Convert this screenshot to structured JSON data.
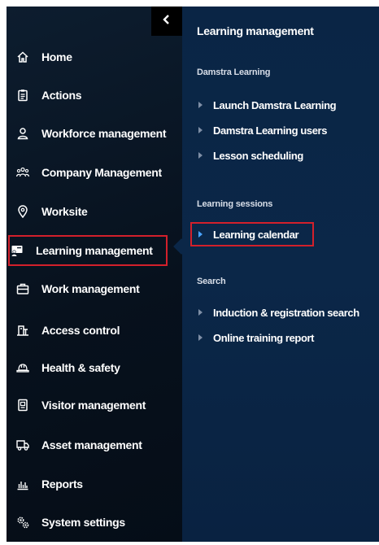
{
  "sidebar": {
    "items": [
      {
        "label": "Home",
        "icon": "home-icon"
      },
      {
        "label": "Actions",
        "icon": "clipboard-icon"
      },
      {
        "label": "Workforce management",
        "icon": "user-icon"
      },
      {
        "label": "Company Management",
        "icon": "users-group-icon"
      },
      {
        "label": "Worksite",
        "icon": "location-pin-icon"
      },
      {
        "label": "Learning management",
        "icon": "learning-presentation-icon"
      },
      {
        "label": "Work management",
        "icon": "briefcase-icon"
      },
      {
        "label": "Access control",
        "icon": "turnstile-icon"
      },
      {
        "label": "Health & safety",
        "icon": "hard-hat-icon"
      },
      {
        "label": "Visitor management",
        "icon": "badge-icon"
      },
      {
        "label": "Asset management",
        "icon": "truck-icon"
      },
      {
        "label": "Reports",
        "icon": "bar-chart-icon"
      },
      {
        "label": "System settings",
        "icon": "gears-icon"
      }
    ],
    "active_index": 5
  },
  "panel": {
    "title": "Learning management",
    "sections": [
      {
        "label": "Damstra Learning",
        "items": [
          "Launch Damstra Learning",
          "Damstra Learning users",
          "Lesson scheduling"
        ]
      },
      {
        "label": "Learning sessions",
        "items": [
          "Learning calendar"
        ]
      },
      {
        "label": "Search",
        "items": [
          "Induction & registration search",
          "Online training report"
        ]
      }
    ]
  },
  "colors": {
    "highlight_outline": "#d3202b",
    "active_chevron": "#4aa3ff",
    "inactive_chevron": "#7f8fa6"
  }
}
